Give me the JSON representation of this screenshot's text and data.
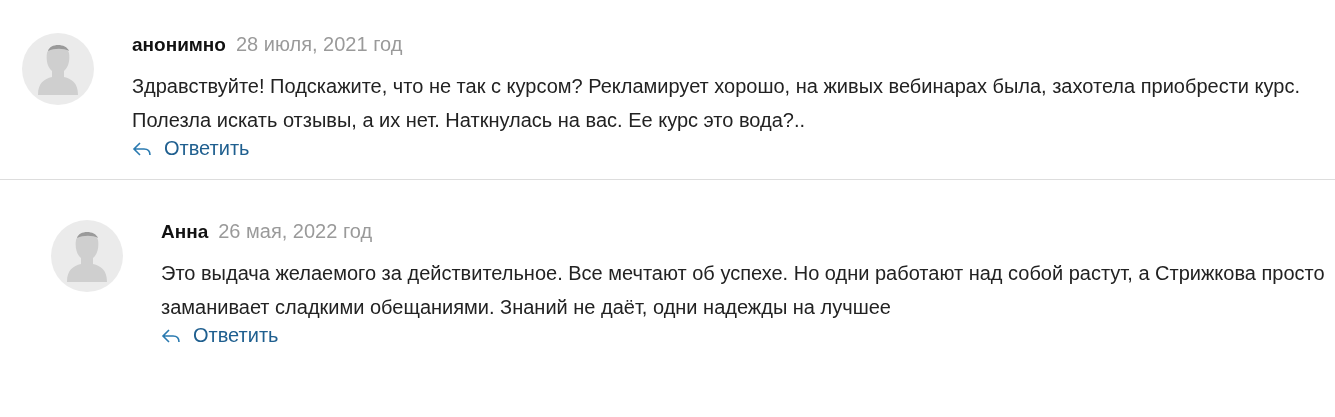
{
  "comments": [
    {
      "author": "анонимно",
      "date": "28 июля, 2021 год",
      "text": "Здравствуйте! Подскажите, что не так с курсом? Рекламирует хорошо, на живых вебинарах была, захотела приобрести курс. Полезла искать отзывы, а их нет. Наткнулась на вас. Ее курс это вода?..",
      "reply_label": "Ответить",
      "kind": "top"
    },
    {
      "author": "Анна",
      "date": "26 мая, 2022 год",
      "text": "Это выдача желаемого за действительное. Все мечтают об успехе. Но одни работают над собой растут, а Стрижкова просто заманивает сладкими обещаниями. Знаний не даёт, одни надежды на лучшее",
      "reply_label": "Ответить",
      "kind": "reply"
    }
  ]
}
